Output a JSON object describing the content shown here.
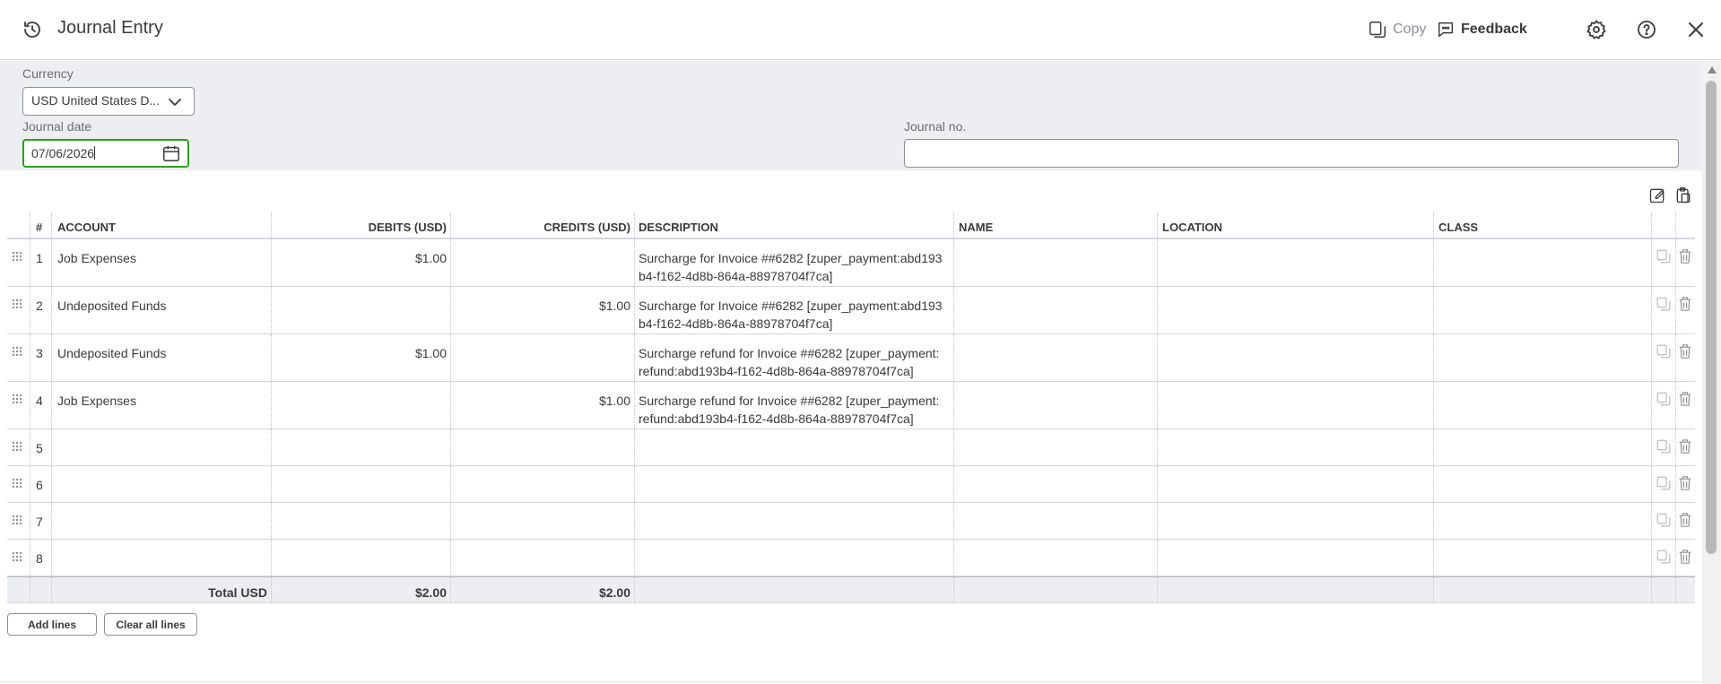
{
  "header": {
    "title": "Journal Entry",
    "copy_label": "Copy",
    "feedback_label": "Feedback"
  },
  "form": {
    "currency_label": "Currency",
    "currency_value": "USD United States D...",
    "date_label": "Journal date",
    "date_value": "07/06/2026",
    "journal_no_label": "Journal no.",
    "journal_no_value": ""
  },
  "table": {
    "headers": {
      "num": "#",
      "account": "ACCOUNT",
      "debits": "DEBITS (USD)",
      "credits": "CREDITS (USD)",
      "description": "DESCRIPTION",
      "name": "NAME",
      "location": "LOCATION",
      "class": "CLASS"
    },
    "rows": [
      {
        "num": "1",
        "account": "Job Expenses",
        "debit": "$1.00",
        "credit": "",
        "description": "Surcharge for Invoice ##6282 [zuper_payment:abd193\nb4-f162-4d8b-864a-88978704f7ca]",
        "name": "",
        "location": "",
        "class": ""
      },
      {
        "num": "2",
        "account": "Undeposited Funds",
        "debit": "",
        "credit": "$1.00",
        "description": "Surcharge for Invoice ##6282 [zuper_payment:abd193\nb4-f162-4d8b-864a-88978704f7ca]",
        "name": "",
        "location": "",
        "class": ""
      },
      {
        "num": "3",
        "account": "Undeposited Funds",
        "debit": "$1.00",
        "credit": "",
        "description": "Surcharge refund for Invoice ##6282 [zuper_payment:\nrefund:abd193b4-f162-4d8b-864a-88978704f7ca]",
        "name": "",
        "location": "",
        "class": ""
      },
      {
        "num": "4",
        "account": "Job Expenses",
        "debit": "",
        "credit": "$1.00",
        "description": "Surcharge refund for Invoice ##6282 [zuper_payment:\nrefund:abd193b4-f162-4d8b-864a-88978704f7ca]",
        "name": "",
        "location": "",
        "class": ""
      },
      {
        "num": "5",
        "account": "",
        "debit": "",
        "credit": "",
        "description": "",
        "name": "",
        "location": "",
        "class": ""
      },
      {
        "num": "6",
        "account": "",
        "debit": "",
        "credit": "",
        "description": "",
        "name": "",
        "location": "",
        "class": ""
      },
      {
        "num": "7",
        "account": "",
        "debit": "",
        "credit": "",
        "description": "",
        "name": "",
        "location": "",
        "class": ""
      },
      {
        "num": "8",
        "account": "",
        "debit": "",
        "credit": "",
        "description": "",
        "name": "",
        "location": "",
        "class": ""
      }
    ],
    "totals": {
      "label": "Total USD",
      "debit": "$2.00",
      "credit": "$2.00"
    }
  },
  "buttons": {
    "add_lines": "Add lines",
    "clear_all_lines": "Clear all lines"
  },
  "colors": {
    "accent_green": "#2ca01c",
    "band_gray": "#eceef1",
    "text": "#393a3d"
  }
}
